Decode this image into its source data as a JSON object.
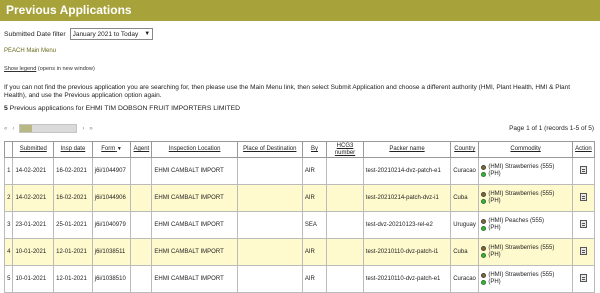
{
  "page": {
    "title": "Previous Applications"
  },
  "filter": {
    "label": "Submitted Date filter",
    "selected": "January 2021 to Today"
  },
  "links": {
    "main_menu": "PEACH Main Menu",
    "show_legend": "Show legend",
    "legend_note": "(opens in new window)"
  },
  "info_text": "If you can not find the previous application you are searching for, then please use the Main Menu link, then select Submit Application and choose a different authority (HMI, Plant Health, HMI & Plant Health), and use the Previous application option again.",
  "summary": {
    "count": "5",
    "text": "Previous applications for EHMI TIM DOBSON FRUIT IMPORTERS LIMITED"
  },
  "pager": {
    "first": "«",
    "prev": "‹",
    "next": "›",
    "last": "»",
    "page_info": "Page 1 of 1 (records 1-5 of 5)",
    "progress": 0.2
  },
  "table": {
    "headers": {
      "num": "",
      "submitted": "Submitted",
      "insp_date": "Insp date",
      "form": "Form",
      "agent": "Agent",
      "inspection_location": "Inspection Location",
      "place_of_destination": "Place of Destination",
      "by": "By",
      "hcg3_number": "HCG3 number",
      "packer_name": "Packer name",
      "country": "Country",
      "commodity": "Commodity",
      "action": "Action"
    },
    "rows": [
      {
        "num": "1",
        "submitted": "14-02-2021",
        "insp_date": "16-02-2021",
        "form": "j6i/1044907",
        "agent": "",
        "inspection_location": "EHMI CAMBALT IMPORT",
        "place_of_destination": "",
        "by": "AIR",
        "hcg3_number": "",
        "packer_name": "test-20210214-dvz-patch-e1",
        "country": "Curacao",
        "commodity_hmi": "(HMI) Strawberries (555)",
        "commodity_ph": "(PH)"
      },
      {
        "num": "2",
        "submitted": "14-02-2021",
        "insp_date": "16-02-2021",
        "form": "j6i/1044906",
        "agent": "",
        "inspection_location": "EHMI CAMBALT IMPORT",
        "place_of_destination": "",
        "by": "AIR",
        "hcg3_number": "",
        "packer_name": "test-20210214-patch-dvz-i1",
        "country": "Cuba",
        "commodity_hmi": "(HMI) Strawberries (555)",
        "commodity_ph": "(PH)"
      },
      {
        "num": "3",
        "submitted": "23-01-2021",
        "insp_date": "25-01-2021",
        "form": "j6i/1040979",
        "agent": "",
        "inspection_location": "EHMI CAMBALT IMPORT",
        "place_of_destination": "",
        "by": "SEA",
        "hcg3_number": "",
        "packer_name": "test-dvz-20210123-rel-e2",
        "country": "Uruguay",
        "commodity_hmi": "(HMI) Peaches (555)",
        "commodity_ph": "(PH)"
      },
      {
        "num": "4",
        "submitted": "10-01-2021",
        "insp_date": "12-01-2021",
        "form": "j6i/1038511",
        "agent": "",
        "inspection_location": "EHMI CAMBALT IMPORT",
        "place_of_destination": "",
        "by": "AIR",
        "hcg3_number": "",
        "packer_name": "test-20210110-dvz-patch-i1",
        "country": "Cuba",
        "commodity_hmi": "(HMI) Strawberries (555)",
        "commodity_ph": "(PH)"
      },
      {
        "num": "5",
        "submitted": "10-01-2021",
        "insp_date": "12-01-2021",
        "form": "j6i/1038510",
        "agent": "",
        "inspection_location": "EHMI CAMBALT IMPORT",
        "place_of_destination": "",
        "by": "AIR",
        "hcg3_number": "",
        "packer_name": "test-20210110-dvz-patch-e1",
        "country": "Curacao",
        "commodity_hmi": "(HMI) Strawberries (555)",
        "commodity_ph": "(PH)"
      }
    ]
  },
  "icons": {
    "hmi_status": "brown-circle-icon",
    "ph_status": "green-circle-icon",
    "action": "document-icon"
  },
  "colors": {
    "title_bar": "#a8a23a",
    "row_highlight": "#fffacd",
    "hmi_dot": "#8b6b23",
    "ph_dot": "#3bb33b"
  }
}
